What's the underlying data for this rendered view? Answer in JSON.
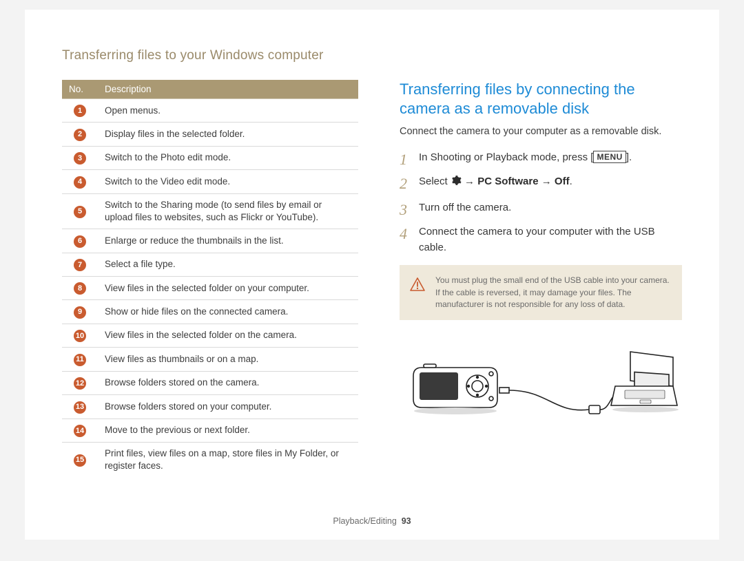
{
  "header": "Transferring files to your Windows computer",
  "table": {
    "head": {
      "no": "No.",
      "desc": "Description"
    },
    "rows": [
      {
        "n": "1",
        "text": "Open menus."
      },
      {
        "n": "2",
        "text": "Display files in the selected folder."
      },
      {
        "n": "3",
        "text": "Switch to the Photo edit mode."
      },
      {
        "n": "4",
        "text": "Switch to the Video edit mode."
      },
      {
        "n": "5",
        "text": "Switch to the Sharing mode (to send files by email or upload files to websites, such as Flickr or YouTube)."
      },
      {
        "n": "6",
        "text": "Enlarge or reduce the thumbnails in the list."
      },
      {
        "n": "7",
        "text": "Select a file type."
      },
      {
        "n": "8",
        "text": "View files in the selected folder on your computer."
      },
      {
        "n": "9",
        "text": "Show or hide files on the connected camera."
      },
      {
        "n": "10",
        "text": "View files in the selected folder on the camera."
      },
      {
        "n": "11",
        "text": "View files as thumbnails or on a map."
      },
      {
        "n": "12",
        "text": "Browse folders stored on the camera."
      },
      {
        "n": "13",
        "text": "Browse folders stored on your computer."
      },
      {
        "n": "14",
        "text": "Move to the previous or next folder."
      },
      {
        "n": "15",
        "text": "Print files, view files on a map, store files in My Folder, or register faces."
      }
    ]
  },
  "right": {
    "title": "Transferring files by connecting the camera as a removable disk",
    "intro": "Connect the camera to your computer as a removable disk.",
    "steps": {
      "s1_a": "In Shooting or Playback mode, press [",
      "s1_menu": "MENU",
      "s1_b": "].",
      "s2_a": "Select ",
      "s2_b": " → ",
      "s2_strong1": "PC Software",
      "s2_c": " → ",
      "s2_strong2": "Off",
      "s2_d": ".",
      "s3": "Turn off the camera.",
      "s4": "Connect the camera to your computer with the USB cable."
    },
    "note": "You must plug the small end of the USB cable into your camera. If the cable is reversed, it may damage your files. The manufacturer is not responsible for any loss of data."
  },
  "footer": {
    "section": "Playback/Editing",
    "page": "93"
  }
}
